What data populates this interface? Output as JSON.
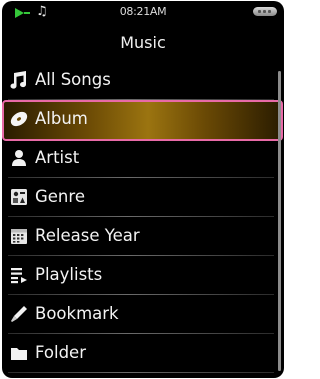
{
  "status_bar": {
    "time": "08:21AM",
    "icons": [
      "play-icon",
      "music-note-icon",
      "battery-icon"
    ],
    "play_color": "#35c83a"
  },
  "header": {
    "title": "Music"
  },
  "menu": {
    "items": [
      {
        "label": "All Songs",
        "icon": "music-note-icon"
      },
      {
        "label": "Album",
        "icon": "disc-icon",
        "selected": true
      },
      {
        "label": "Artist",
        "icon": "person-icon"
      },
      {
        "label": "Genre",
        "icon": "genre-icon"
      },
      {
        "label": "Release Year",
        "icon": "calendar-icon"
      },
      {
        "label": "Playlists",
        "icon": "playlist-icon"
      },
      {
        "label": "Bookmark",
        "icon": "bookmark-icon"
      },
      {
        "label": "Folder",
        "icon": "folder-icon"
      }
    ],
    "highlight_border_color": "#e86aa7"
  }
}
